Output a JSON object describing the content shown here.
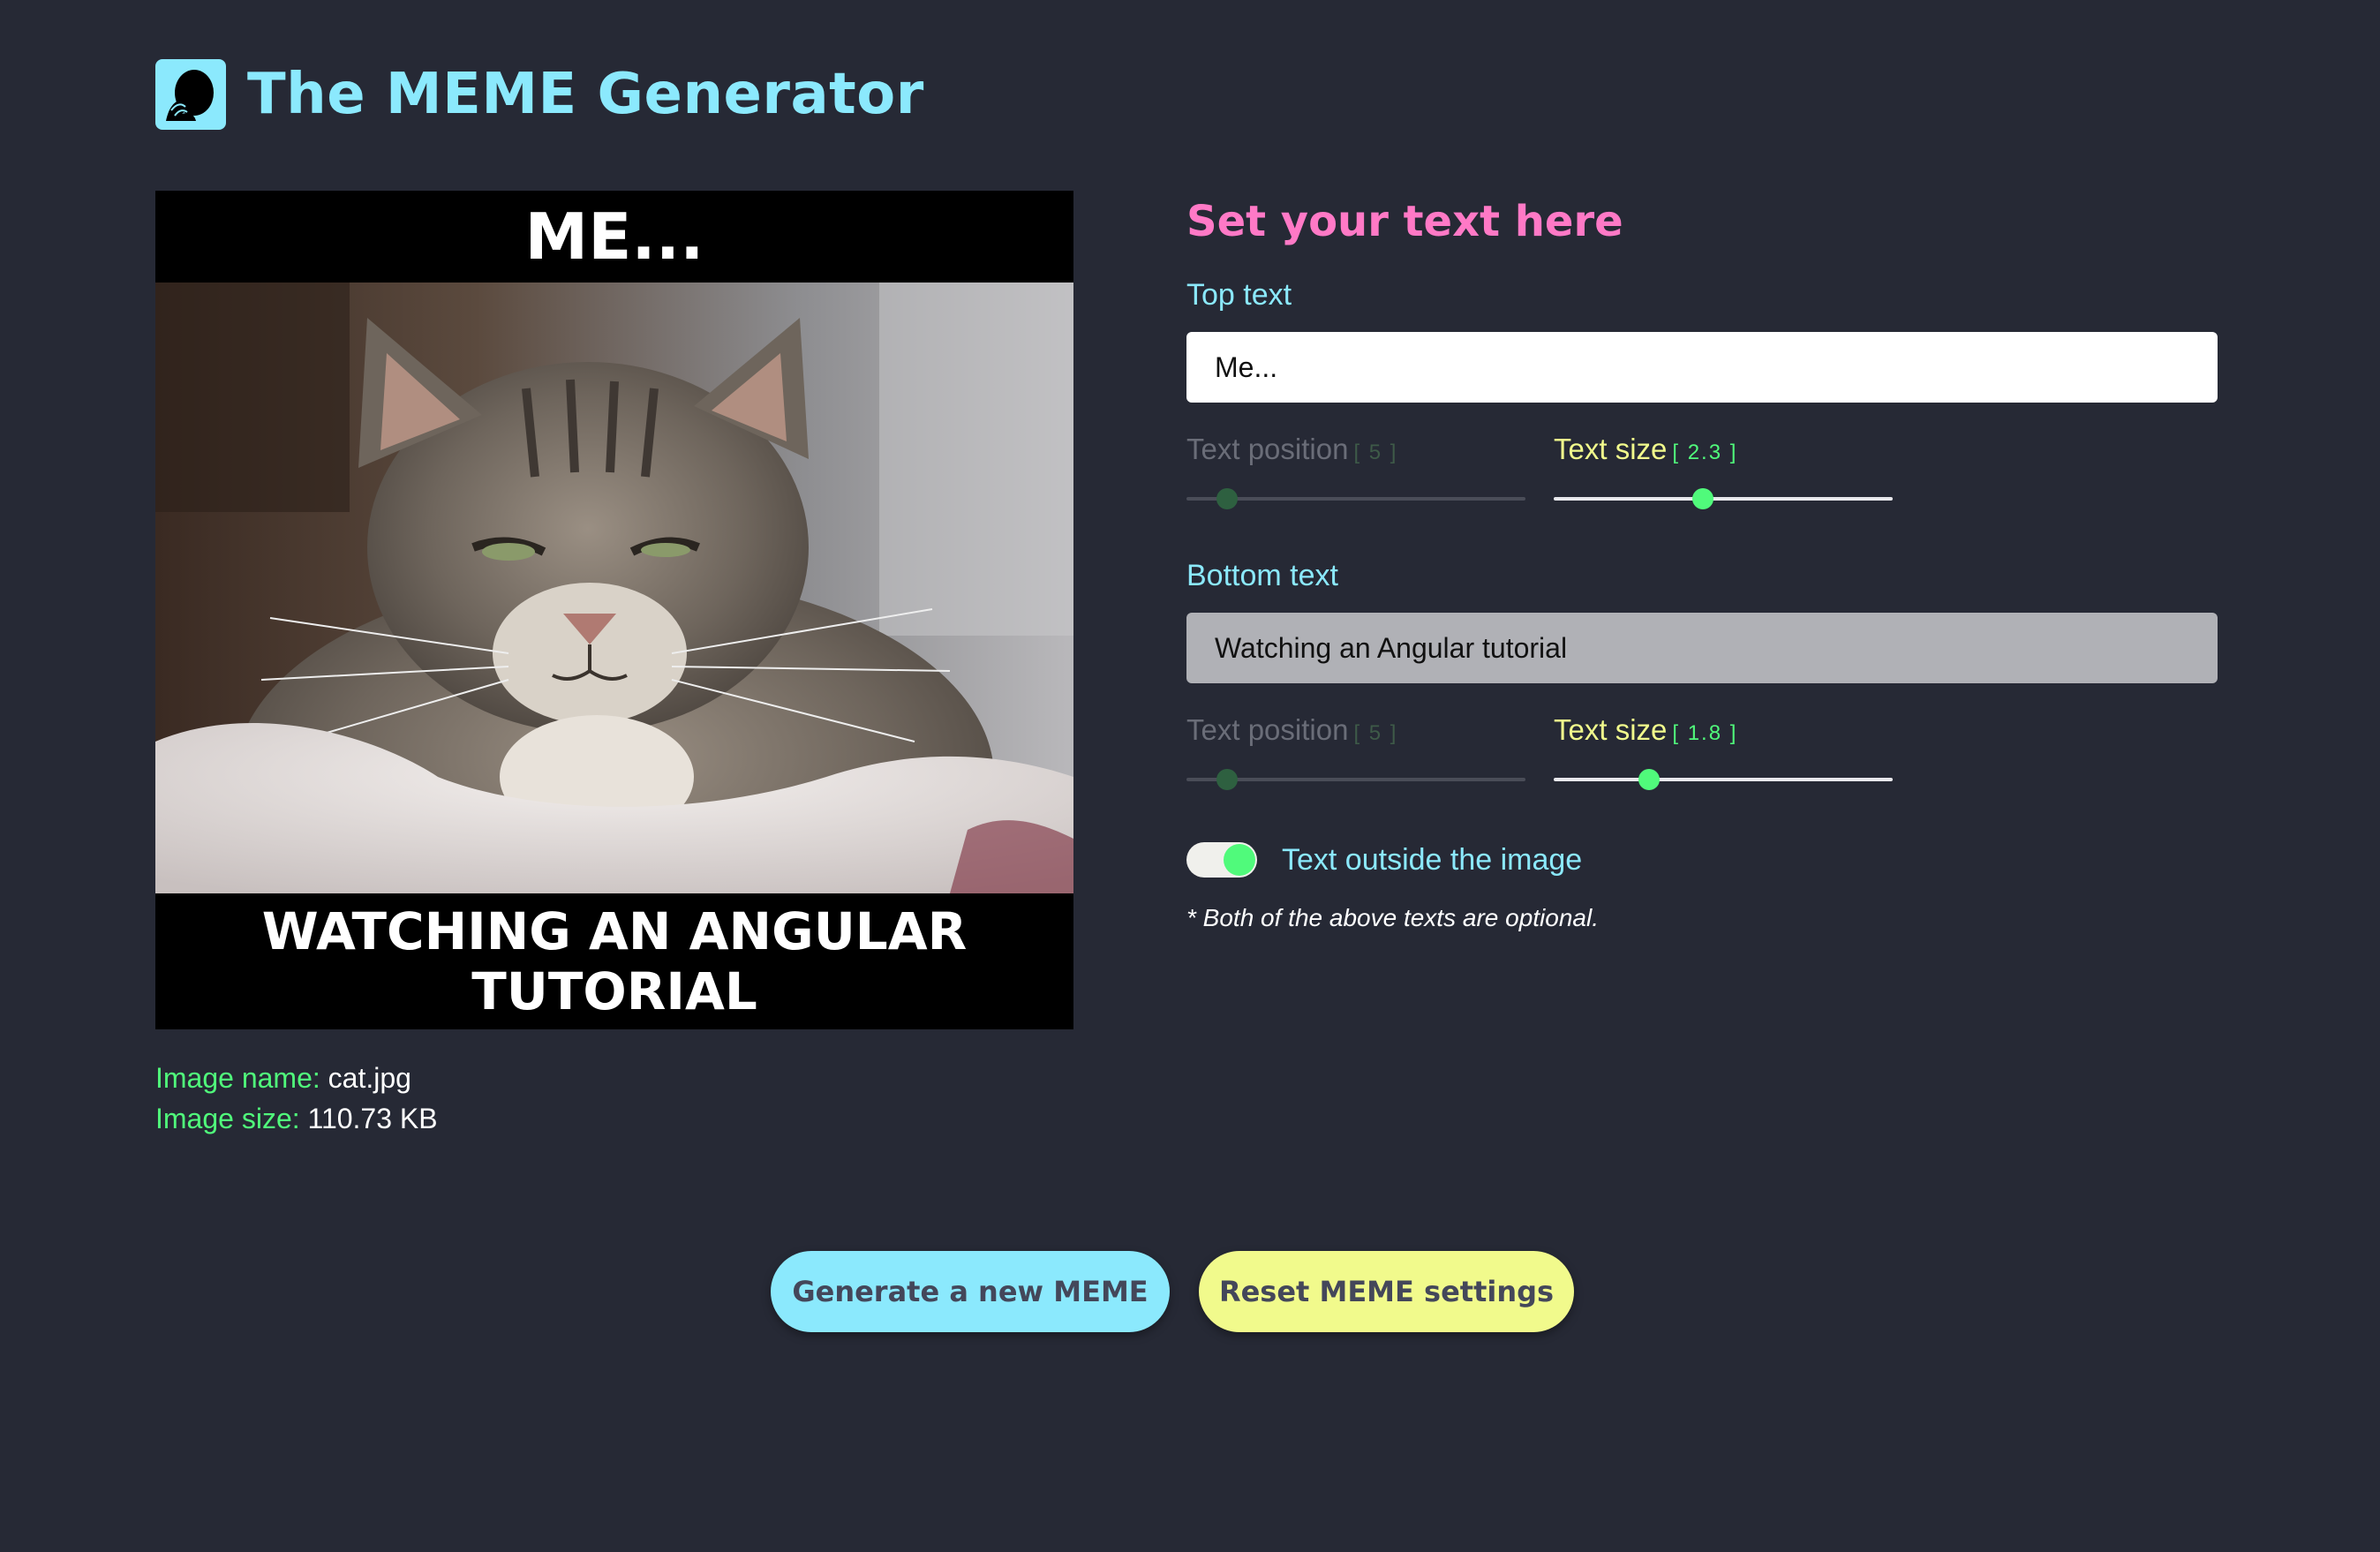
{
  "app": {
    "title": "The MEME Generator",
    "logo_icon": "face-palm-icon"
  },
  "meme": {
    "top_text": "Me...",
    "bottom_text": "Watching an Angular tutorial",
    "image_alt": "grumpy tabby cat"
  },
  "image_info": {
    "name_label": "Image name:",
    "name_value": "cat.jpg",
    "size_label": "Image size:",
    "size_value": "110.73 KB"
  },
  "settings": {
    "heading": "Set your text here",
    "top": {
      "label": "Top text",
      "value": "Me...",
      "position_label": "Text position",
      "position_value": "[ 5 ]",
      "position_fraction": 0.12,
      "size_label": "Text size",
      "size_value": "[ 2.3 ]",
      "size_fraction": 0.44
    },
    "bottom": {
      "label": "Bottom text",
      "value": "Watching an Angular tutorial",
      "position_label": "Text position",
      "position_value": "[ 5 ]",
      "position_fraction": 0.12,
      "size_label": "Text size",
      "size_value": "[ 1.8 ]",
      "size_fraction": 0.28
    },
    "toggle_label": "Text outside the image",
    "toggle_on": true,
    "note": "* Both of the above texts are optional."
  },
  "buttons": {
    "generate": "Generate a new MEME",
    "reset": "Reset MEME settings"
  },
  "colors": {
    "background": "#262935",
    "cyan": "#8be9fd",
    "pink": "#ff79c6",
    "green": "#50fa7b",
    "yellow": "#f1fa8c"
  }
}
